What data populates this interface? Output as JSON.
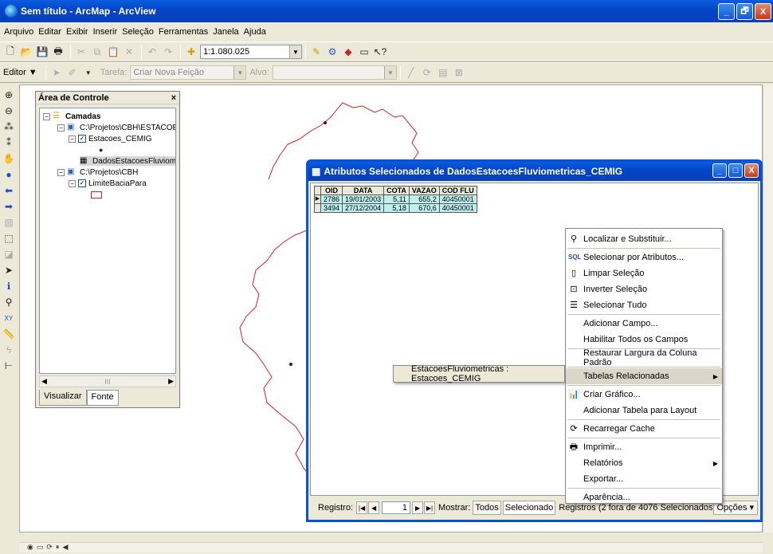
{
  "window": {
    "title": "Sem título - ArcMap - ArcView",
    "btn_min": "_",
    "btn_max": "🗗",
    "btn_close": "X"
  },
  "menu": [
    "Arquivo",
    "Editar",
    "Exibir",
    "Inserir",
    "Seleção",
    "Ferramentas",
    "Janela",
    "Ajuda"
  ],
  "toolbar1": {
    "scale": "1:1.080.025"
  },
  "toolbar2": {
    "editor": "Editor ▼",
    "task_label": "Tarefa:",
    "task_value": "Criar Nova Feição",
    "target_label": "Alvo:"
  },
  "toc": {
    "title": "Área de Controle",
    "close": "×",
    "layers_root": "Camadas",
    "group1": "C:\\Projetos\\CBH\\ESTACOE",
    "layer1": "Estacoes_CEMIG",
    "table1": "DadosEstacoesFluviom",
    "group2": "C:\\Projetos\\CBH",
    "layer2": "LimiteBaciaPara",
    "tab_display": "Visualizar",
    "tab_source": "Fonte",
    "scroll_mid": "III"
  },
  "attributes": {
    "title": "Atributos Selecionados de DadosEstacoesFluviometricas_CEMIG",
    "columns": [
      "OID",
      "DATA",
      "COTA",
      "VAZAO",
      "COD FLU"
    ],
    "rows": [
      [
        "2786",
        "19/01/2003",
        "5,11",
        "655,2",
        "40450001"
      ],
      [
        "3494",
        "27/12/2004",
        "5,18",
        "670,6",
        "40450001"
      ]
    ],
    "footer": {
      "registro_label": "Registro:",
      "registro_value": "1",
      "show_label": "Mostrar:",
      "all_btn": "Todos",
      "selected_btn": "Selecionado",
      "records_text": "Registros (2 fora de  4076 Selecionados)",
      "options": "Opções ▾"
    }
  },
  "context_menu": {
    "items": [
      {
        "label": "Localizar e Substituir...",
        "icon": "binoculars-icon"
      },
      {
        "label": "Selecionar por Atributos...",
        "icon": "sql-icon"
      },
      {
        "label": "Limpar Seleção",
        "icon": "clear-selection-icon"
      },
      {
        "label": "Inverter Seleção",
        "icon": "invert-selection-icon"
      },
      {
        "label": "Selecionar Tudo",
        "icon": "select-all-icon"
      },
      {
        "label": "Adicionar Campo..."
      },
      {
        "label": "Habilitar Todos os Campos"
      },
      {
        "label": "Restaurar Largura da Coluna Padrão"
      },
      {
        "label": "Tabelas Relacionadas"
      },
      {
        "label": "Criar Gráfico...",
        "icon": "chart-icon"
      },
      {
        "label": "Adicionar Tabela para Layout"
      },
      {
        "label": "Recarregar Cache",
        "icon": "refresh-icon"
      },
      {
        "label": "Imprimir...",
        "icon": "printer-icon"
      },
      {
        "label": "Relatórios"
      },
      {
        "label": "Exportar..."
      },
      {
        "label": "Aparência..."
      }
    ],
    "submenu_item": "EstacoesFluviometricas : Estacoes_CEMIG"
  }
}
